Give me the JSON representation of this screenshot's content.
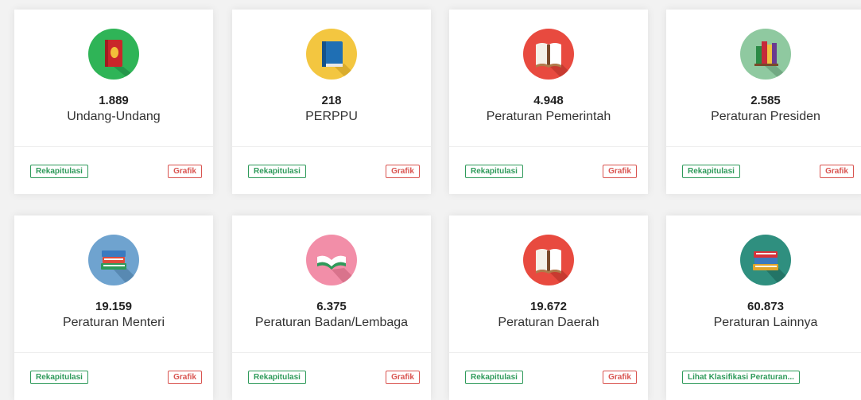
{
  "cards": [
    {
      "count": "1.889",
      "label": "Undang-Undang",
      "icon": "red-book-icon",
      "rekap": "Rekapitulasi",
      "grafik": "Grafik"
    },
    {
      "count": "218",
      "label": "PERPPU",
      "icon": "blue-book-icon",
      "rekap": "Rekapitulasi",
      "grafik": "Grafik"
    },
    {
      "count": "4.948",
      "label": "Peraturan Pemerintah",
      "icon": "open-book-icon",
      "rekap": "Rekapitulasi",
      "grafik": "Grafik"
    },
    {
      "count": "2.585",
      "label": "Peraturan Presiden",
      "icon": "books-shelf-icon",
      "rekap": "Rekapitulasi",
      "grafik": "Grafik"
    },
    {
      "count": "19.159",
      "label": "Peraturan Menteri",
      "icon": "book-stack-icon",
      "rekap": "Rekapitulasi",
      "grafik": "Grafik"
    },
    {
      "count": "6.375",
      "label": "Peraturan Badan/Lembaga",
      "icon": "open-book-icon",
      "rekap": "Rekapitulasi",
      "grafik": "Grafik"
    },
    {
      "count": "19.672",
      "label": "Peraturan Daerah",
      "icon": "open-book-icon",
      "rekap": "Rekapitulasi",
      "grafik": "Grafik"
    },
    {
      "count": "60.873",
      "label": "Peraturan Lainnya",
      "icon": "book-stack-icon",
      "klasifikasi": "Lihat Klasifikasi Peraturan..."
    }
  ],
  "colors": {
    "green": "#2e9a5a",
    "red": "#d9534f"
  }
}
